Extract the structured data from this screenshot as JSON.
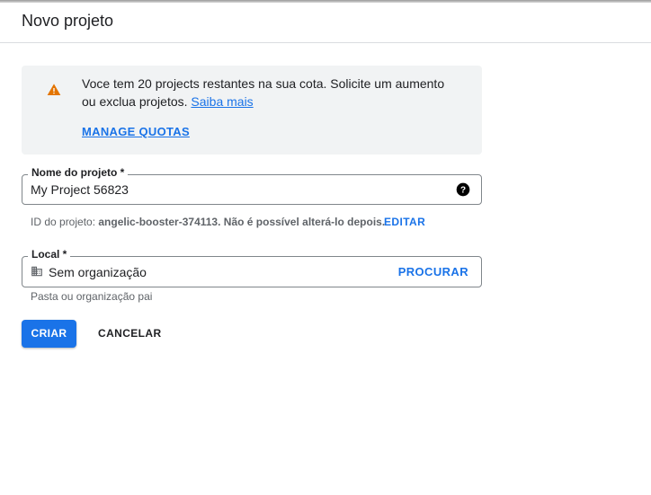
{
  "page": {
    "title": "Novo projeto"
  },
  "notice": {
    "text": "Voce tem 20 projects restantes na sua cota. Solicite um aumento ou exclua projetos.",
    "link_label": "Saiba mais",
    "action_label": "MANAGE QUOTAS",
    "icon": "warning-icon",
    "icon_color": "#e37400"
  },
  "project_name": {
    "label": "Nome do projeto *",
    "value": "My Project 56823",
    "help_icon": "help-icon"
  },
  "project_id": {
    "prefix": "ID do projeto: ",
    "id": "angelic-booster-374113",
    "suffix": ". Não é possível alterá-lo depois.",
    "edit_label": "EDITAR"
  },
  "location": {
    "label": "Local *",
    "value": "Sem organização",
    "icon": "organization-icon",
    "browse_label": "PROCURAR",
    "helper": "Pasta ou organização pai"
  },
  "actions": {
    "create_label": "CRIAR",
    "cancel_label": "CANCELAR"
  },
  "colors": {
    "accent": "#1a73e8",
    "notice_bg": "#f1f3f4",
    "warning": "#e37400"
  }
}
